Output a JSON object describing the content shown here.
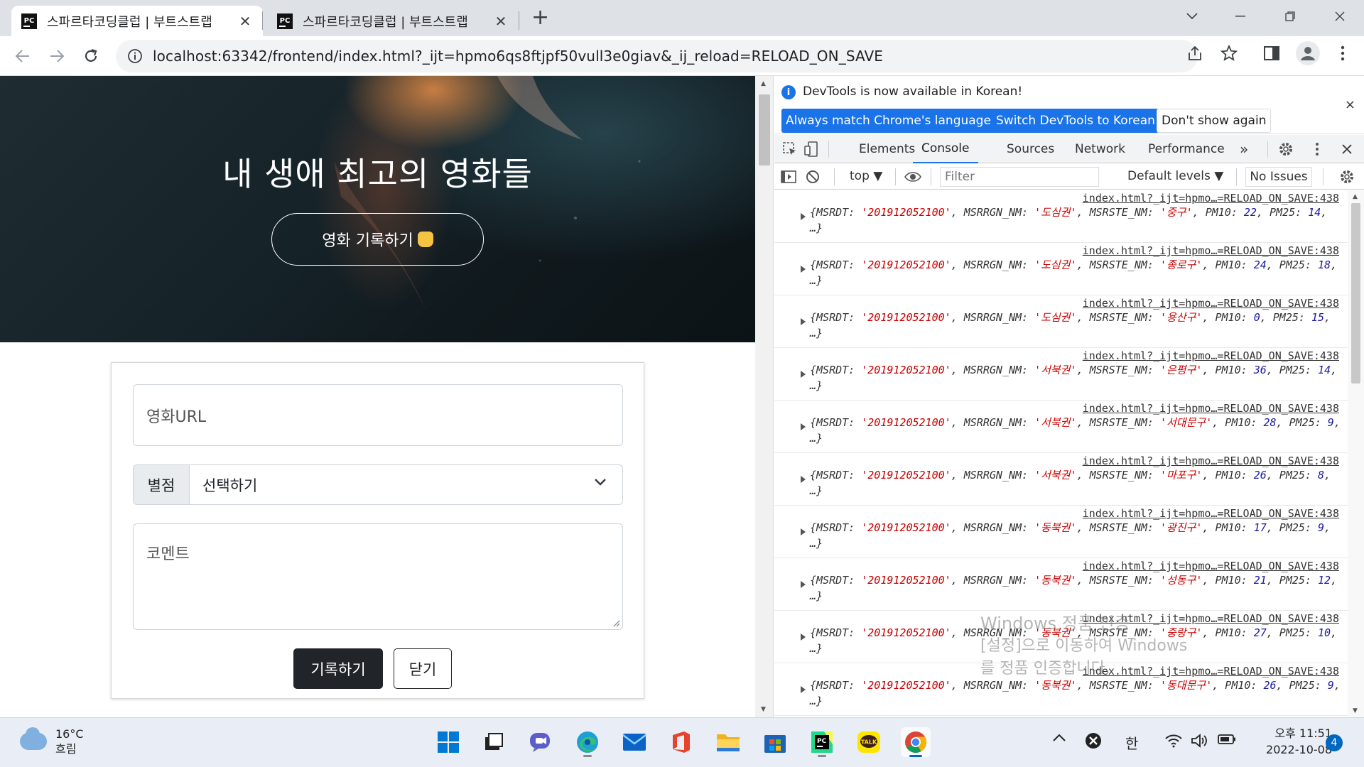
{
  "browser": {
    "tabs": [
      {
        "title": "스파르타코딩클럽 | 부트스트랩",
        "active": true
      },
      {
        "title": "스파르타코딩클럽 | 부트스트랩",
        "active": false
      }
    ],
    "favicon_text": "PC",
    "new_tab": "+",
    "url": "localhost:63342/frontend/index.html?_ijt=hpmo6qs8ftjpf50vull3e0giav&_ij_reload=RELOAD_ON_SAVE"
  },
  "page": {
    "hero_title": "내 생애 최고의 영화들",
    "hero_button": "영화 기록하기",
    "form": {
      "url_placeholder": "영화URL",
      "rating_label": "별점",
      "rating_selected": "선택하기",
      "comment_placeholder": "코멘트",
      "record_button": "기록하기",
      "close_button": "닫기"
    }
  },
  "devtools": {
    "banner": {
      "message": "DevTools is now available in Korean!",
      "btn_match": "Always match Chrome's language",
      "btn_switch": "Switch DevTools to Korean",
      "btn_dismiss": "Don't show again",
      "close": "×"
    },
    "tabs": [
      "Elements",
      "Console",
      "Sources",
      "Network",
      "Performance"
    ],
    "more_tabs": "»",
    "console": {
      "context": "top",
      "filter_placeholder": "Filter",
      "levels": "Default levels",
      "issues": "No Issues"
    },
    "log_source": "index.html?_ijt=hpmo…=RELOAD_ON_SAVE:438",
    "logs": [
      {
        "date": "'201912052100'",
        "region": "'도심권'",
        "station": "'중구'",
        "pm10": "22",
        "pm25": "14"
      },
      {
        "date": "'201912052100'",
        "region": "'도심권'",
        "station": "'종로구'",
        "pm10": "24",
        "pm25": "18"
      },
      {
        "date": "'201912052100'",
        "region": "'도심권'",
        "station": "'용산구'",
        "pm10": "0",
        "pm25": "15"
      },
      {
        "date": "'201912052100'",
        "region": "'서북권'",
        "station": "'은평구'",
        "pm10": "36",
        "pm25": "14"
      },
      {
        "date": "'201912052100'",
        "region": "'서북권'",
        "station": "'서대문구'",
        "pm10": "28",
        "pm25": "9"
      },
      {
        "date": "'201912052100'",
        "region": "'서북권'",
        "station": "'마포구'",
        "pm10": "26",
        "pm25": "8"
      },
      {
        "date": "'201912052100'",
        "region": "'동북권'",
        "station": "'광진구'",
        "pm10": "17",
        "pm25": "9"
      },
      {
        "date": "'201912052100'",
        "region": "'동북권'",
        "station": "'성동구'",
        "pm10": "21",
        "pm25": "12"
      },
      {
        "date": "'201912052100'",
        "region": "'동북권'",
        "station": "'중랑구'",
        "pm10": "27",
        "pm25": "10"
      },
      {
        "date": "'201912052100'",
        "region": "'동북권'",
        "station": "'동대문구'",
        "pm10": "26",
        "pm25": "9"
      }
    ]
  },
  "watermark": {
    "line1": "Windows 정품 인증",
    "line2": "[설정]으로 이동하여 Windows를 정품 인증합니다."
  },
  "taskbar": {
    "weather_temp": "16°C",
    "weather_desc": "흐림",
    "ime": "한",
    "time": "오후 11:51",
    "date": "2022-10-08",
    "notifications": "4",
    "kakao_label": "TALK"
  },
  "colors": {
    "devtools_accent": "#1a73e8",
    "string_value": "#c80000",
    "number_value": "#1a1aa6",
    "dark_button": "#212529"
  }
}
